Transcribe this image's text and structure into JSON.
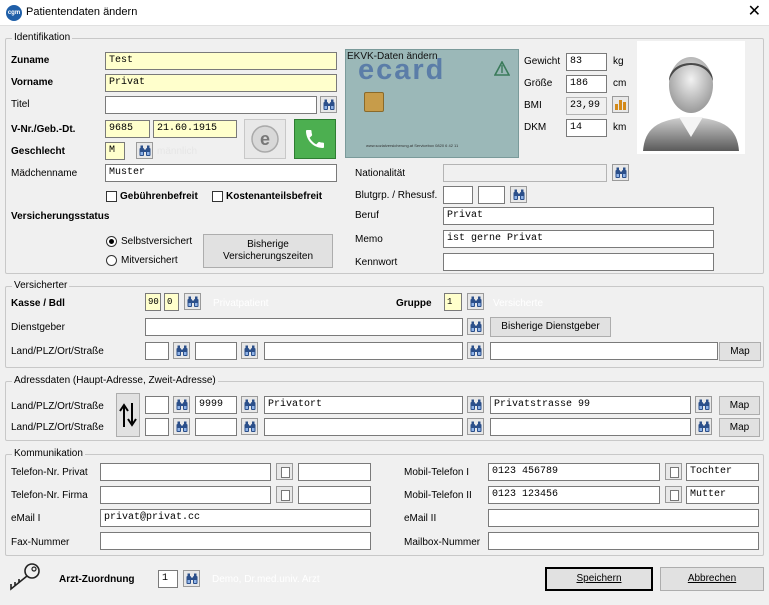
{
  "window": {
    "title": "Patientendaten ändern",
    "close_glyph": "✕",
    "app_icon_text": "cgm"
  },
  "identifikation": {
    "group_label": "Identifikation",
    "zuname": {
      "label": "Zuname",
      "value": "Test"
    },
    "vorname": {
      "label": "Vorname",
      "value": "Privat"
    },
    "titel": {
      "label": "Titel",
      "value": ""
    },
    "vnr": {
      "label": "V-Nr./Geb.-Dt.",
      "value": "9685",
      "birthdate": "21.60.1915"
    },
    "geschlecht": {
      "label": "Geschlecht",
      "value": "M",
      "hint": "männlich"
    },
    "maedchenname": {
      "label": "Mädchenname",
      "value": "Muster"
    },
    "gebuehrenbefreit": "Gebührenbefreit",
    "kostenanteilsbefreit": "Kostenanteilsbefreit",
    "versicherungsstatus": "Versicherungsstatus",
    "selbstversichert": "Selbstversichert",
    "mitversichert": "Mitversichert",
    "bisherige_versicherungszeiten": "Bisherige Versicherungszeiten",
    "ecard": {
      "label": "EKVK-Daten ändern",
      "brand": "ecard",
      "small_text": "www.sozialversicherung.at  Servicebox 0820 6 42 11"
    },
    "gewicht": {
      "label": "Gewicht",
      "value": "83",
      "unit": "kg"
    },
    "groesse": {
      "label": "Größe",
      "value": "186",
      "unit": "cm"
    },
    "bmi": {
      "label": "BMI",
      "value": "23,99"
    },
    "dkm": {
      "label": "DKM",
      "value": "14",
      "unit": "km"
    },
    "nationalitaet": {
      "label": "Nationalität",
      "value": ""
    },
    "blutgruppe": {
      "label": "Blutgrp. / Rhesusf."
    },
    "beruf": {
      "label": "Beruf",
      "value": "Privat"
    },
    "memo": {
      "label": "Memo",
      "value": "ist gerne Privat"
    },
    "kennwort": {
      "label": "Kennwort",
      "value": ""
    }
  },
  "versicherter": {
    "group_label": "Versicherter",
    "kasse": {
      "label": "Kasse / Bdl",
      "value": "90",
      "bdl": "0",
      "name": "Privatpatient"
    },
    "gruppe": {
      "label": "Gruppe",
      "value": "1",
      "name": "Versicherte"
    },
    "dienstgeber": {
      "label": "Dienstgeber",
      "value": ""
    },
    "bisherige_dienstgeber": "Bisherige Dienstgeber",
    "land": {
      "label": "Land/PLZ/Ort/Straße"
    },
    "map_label": "Map"
  },
  "adressdaten": {
    "group_label": "Adressdaten  (Haupt-Adresse,  Zweit-Adresse)",
    "row1": {
      "label": "Land/PLZ/Ort/Straße",
      "plz": "9999",
      "ort": "Privatort",
      "strasse": "Privatstrasse 99"
    },
    "row2": {
      "label": "Land/PLZ/Ort/Straße"
    },
    "map_label": "Map"
  },
  "kommunikation": {
    "group_label": "Kommunikation",
    "telefon_privat": {
      "label": "Telefon-Nr. Privat",
      "value": ""
    },
    "telefon_firma": {
      "label": "Telefon-Nr. Firma",
      "value": ""
    },
    "email1": {
      "label": "eMail I",
      "value": "privat@privat.cc"
    },
    "fax": {
      "label": "Fax-Nummer",
      "value": ""
    },
    "mobil1": {
      "label": "Mobil-Telefon I",
      "value": "0123 456789",
      "note": "Tochter"
    },
    "mobil2": {
      "label": "Mobil-Telefon II",
      "value": "0123 123456",
      "note": "Mutter"
    },
    "email2": {
      "label": "eMail II",
      "value": ""
    },
    "mailbox": {
      "label": "Mailbox-Nummer",
      "value": ""
    }
  },
  "footer": {
    "arzt_label": "Arzt-Zuordnung",
    "arzt_value": "1",
    "arzt_name": "Demo, Dr.med.univ. Arzt",
    "save": "Speichern",
    "cancel": "Abbrechen"
  }
}
